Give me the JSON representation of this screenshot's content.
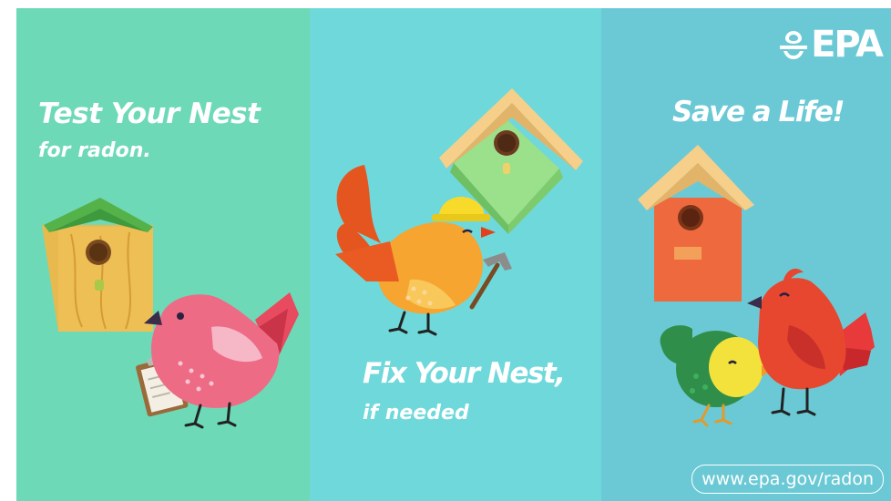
{
  "colors": {
    "left_bg": "#6ED9B7",
    "middle_bg": "#6FD8DB",
    "right_bg": "#6BC9D6",
    "text": "#FFFFFF"
  },
  "panels": {
    "left": {
      "headline": "Test Your Nest",
      "subline": "for radon."
    },
    "middle": {
      "headline": "Fix Your Nest,",
      "subline": "if needed"
    },
    "right": {
      "headline": "Save a Life!",
      "logo_text": "EPA",
      "logo_icon": "epa-flower-icon",
      "url": "www.epa.gov/radon"
    }
  }
}
